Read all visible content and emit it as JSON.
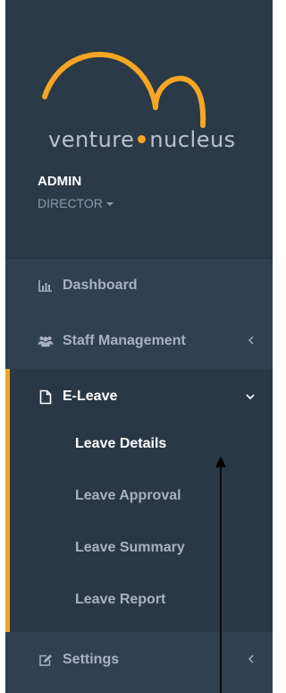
{
  "branding": {
    "logo_text_left": "venture",
    "logo_text_right": "nucleus",
    "accent_color": "#f6a623"
  },
  "profile": {
    "name": "ADMIN",
    "role": "DIRECTOR"
  },
  "nav": {
    "dashboard": {
      "label": "Dashboard",
      "icon": "bar-chart-icon"
    },
    "staff_management": {
      "label": "Staff Management",
      "icon": "users-icon"
    },
    "eleave": {
      "label": "E-Leave",
      "icon": "file-icon",
      "expanded": true,
      "items": [
        {
          "label": "Leave Details",
          "active": true
        },
        {
          "label": "Leave Approval",
          "active": false
        },
        {
          "label": "Leave Summary",
          "active": false
        },
        {
          "label": "Leave Report",
          "active": false
        }
      ]
    },
    "settings": {
      "label": "Settings",
      "icon": "edit-icon"
    }
  },
  "colors": {
    "sidebar_bg": "#2f4050",
    "active_bg": "#293846",
    "active_bar": "#f5a21b",
    "text_muted": "#a7b1c2"
  }
}
